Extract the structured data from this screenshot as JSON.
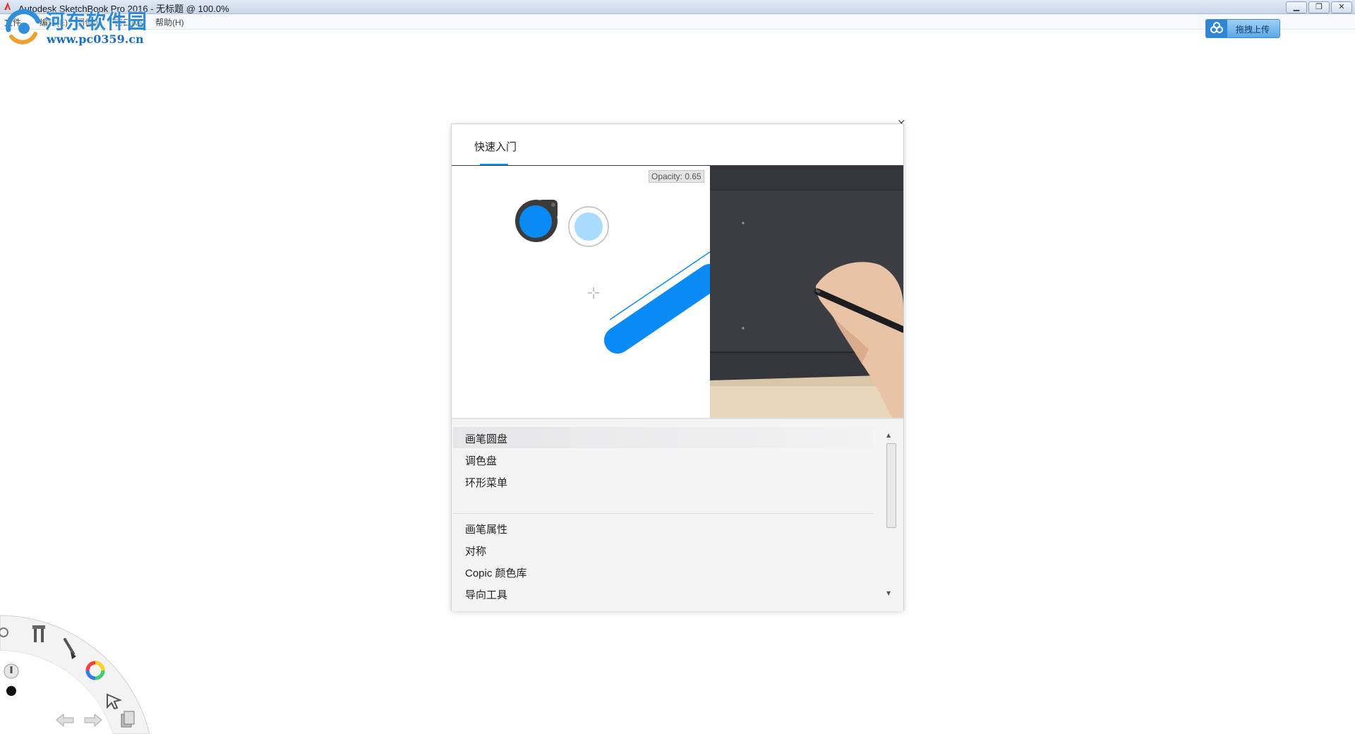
{
  "window": {
    "title": "Autodesk SketchBook Pro 2016 - 无标题 @ 100.0%",
    "controls": [
      "minimize",
      "restore",
      "close"
    ]
  },
  "menubar": {
    "items": [
      "文件",
      "编辑(E)",
      "图像(I)",
      "窗口(W)",
      "帮助(H)"
    ]
  },
  "watermark": {
    "name": "河东软件园",
    "url": "www.pc0359.cn"
  },
  "upload": {
    "label": "拖拽上传"
  },
  "dialog": {
    "tab": "快速入门",
    "demo": {
      "opacity_label": "Opacity: 0.65"
    },
    "list": {
      "group1": [
        "画笔圆盘",
        "调色盘",
        "环形菜单"
      ],
      "group2": [
        "画笔属性",
        "对称",
        "Copic 颜色库",
        "导向工具"
      ],
      "selected_index": 0
    }
  },
  "colors": {
    "accent": "#1e8fe8",
    "stroke": "#0a8af5",
    "tablet": "#3a3b40",
    "titlebar": "#d4e1f0"
  },
  "icons": {
    "radial": [
      "brush-puck-icon",
      "color-puck-icon",
      "tools-icon",
      "brush-icon",
      "color-wheel-icon",
      "select-icon",
      "undo-icon",
      "redo-icon",
      "layers-icon"
    ]
  }
}
